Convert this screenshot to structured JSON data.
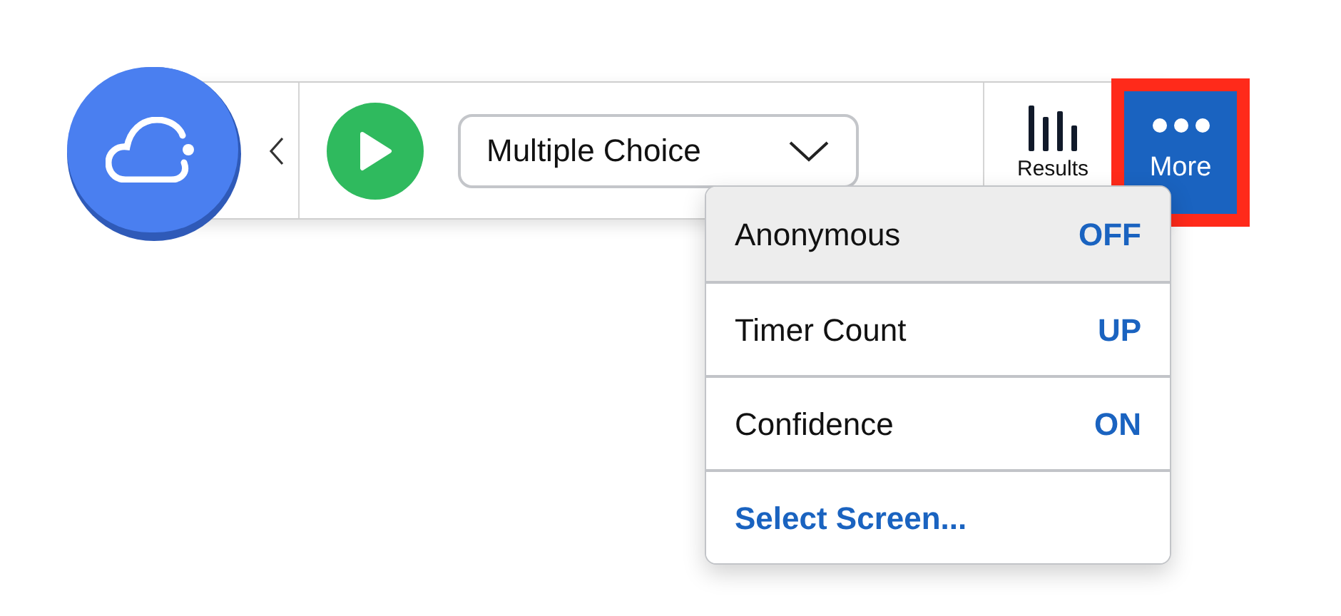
{
  "toolbar": {
    "question_type": "Multiple Choice",
    "results_label": "Results",
    "more": {
      "label": "More",
      "annotated": true
    }
  },
  "menu": {
    "items": [
      {
        "kind": "toggle",
        "label": "Anonymous",
        "value": "OFF",
        "selected": true
      },
      {
        "kind": "toggle",
        "label": "Timer Count",
        "value": "UP",
        "selected": false
      },
      {
        "kind": "toggle",
        "label": "Confidence",
        "value": "ON",
        "selected": false
      },
      {
        "kind": "action",
        "label": "Select Screen...",
        "selected": false
      }
    ]
  }
}
